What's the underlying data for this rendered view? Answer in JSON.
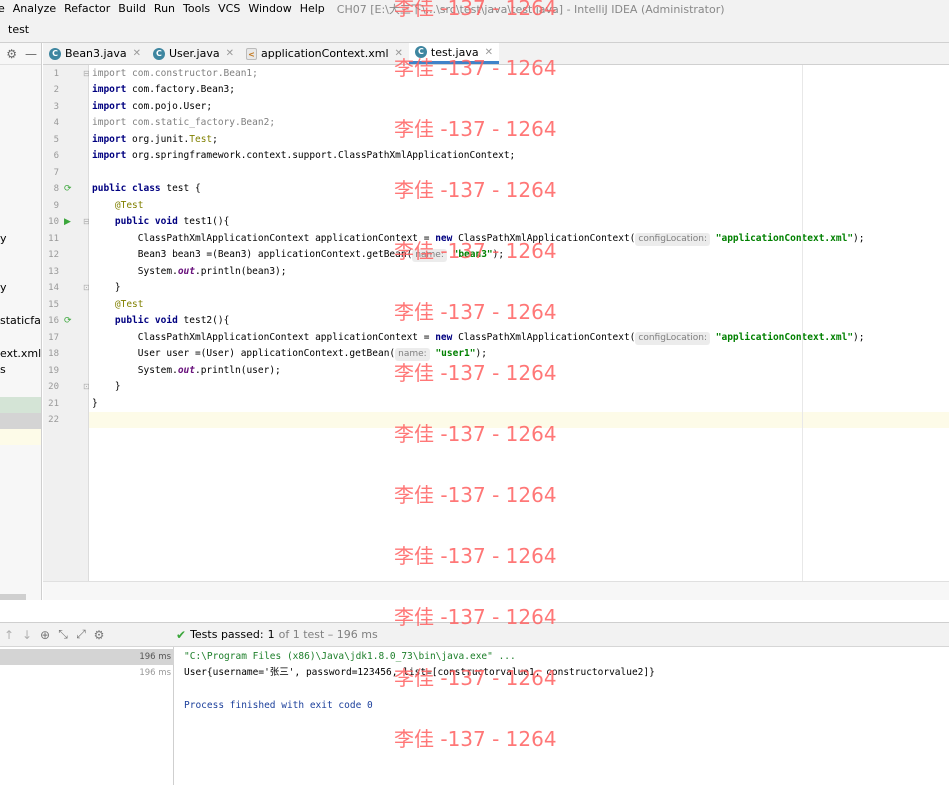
{
  "menubar": {
    "items": [
      "e",
      "Analyze",
      "Refactor",
      "Build",
      "Run",
      "Tools",
      "VCS",
      "Window",
      "Help"
    ],
    "window_title": "CH07 [E:\\大三下\\...\\src\\test\\java\\test.java] - IntelliJ IDEA (Administrator)"
  },
  "navbar": {
    "project": "test"
  },
  "project_panel": {
    "items": [
      "y",
      "y",
      "staticfact",
      "ext.xml",
      "s"
    ]
  },
  "tabs": [
    {
      "label": "Bean3.java",
      "icon": "java-class-icon",
      "active": false
    },
    {
      "label": "User.java",
      "icon": "java-class-icon",
      "active": false
    },
    {
      "label": "applicationContext.xml",
      "icon": "xml-file-icon",
      "active": false
    },
    {
      "label": "test.java",
      "icon": "java-class-icon",
      "active": true
    }
  ],
  "editor": {
    "line_numbers": [
      "1",
      "2",
      "3",
      "4",
      "5",
      "6",
      "7",
      "8",
      "9",
      "10",
      "11",
      "12",
      "13",
      "14",
      "15",
      "16",
      "17",
      "18",
      "19",
      "20",
      "21",
      "22"
    ],
    "lines": {
      "l1_kw": "import",
      "l1_rest": " com.constructor.Bean1;",
      "l2_kw": "import",
      "l2_rest": " com.factory.Bean3;",
      "l3_kw": "import",
      "l3_rest": " com.pojo.User;",
      "l4_kw": "import",
      "l4_rest": " com.static_factory.Bean2;",
      "l5_kw": "import",
      "l5_a": " org.junit.",
      "l5_ann": "Test",
      "l5_b": ";",
      "l6_kw": "import",
      "l6_rest": " org.springframework.context.support.ClassPathXmlApplicationContext;",
      "l8_kw": "public class",
      "l8_rest": " test {",
      "l9_ann": "@Test",
      "l10_kw": "public void",
      "l10_rest": " test1(){",
      "l11_a": "ClassPathXmlApplicationContext applicationContext = ",
      "l11_kw": "new",
      "l11_b": " ClassPathXmlApplicationContext(",
      "l11_hint": "configLocation:",
      "l11_str": "\"applicationContext.xml\"",
      "l11_c": ");",
      "l12_a": "Bean3 bean3 =(Bean3) applicationContext.getBean(",
      "l12_hint": "name:",
      "l12_str": "\"bean3\"",
      "l12_c": ");",
      "l13_a": "System.",
      "l13_fld": "out",
      "l13_b": ".println(bean3);",
      "l14": "}",
      "l15_ann": "@Test",
      "l16_kw": "public void",
      "l16_rest": " test2(){",
      "l17_a": "ClassPathXmlApplicationContext applicationContext = ",
      "l17_kw": "new",
      "l17_b": " ClassPathXmlApplicationContext(",
      "l17_hint": "configLocation:",
      "l17_str": "\"applicationContext.xml\"",
      "l17_c": ");",
      "l18_a": "User user =(User) applicationContext.getBean(",
      "l18_hint": "name:",
      "l18_str": "\"user1\"",
      "l18_c": ");",
      "l19_a": "System.",
      "l19_fld": "out",
      "l19_b": ".println(user);",
      "l20": "}",
      "l21": "}"
    }
  },
  "run": {
    "status_label": "Tests passed:",
    "status_count": "1",
    "status_rest": "of 1 test – 196 ms",
    "tree": [
      {
        "time": "196 ms"
      },
      {
        "time": "196 ms"
      }
    ],
    "console": {
      "cmd": "\"C:\\Program Files (x86)\\Java\\jdk1.8.0_73\\bin\\java.exe\" ...",
      "output": "User{username='张三', password=123456, list=[constructorvalue1, constructorvalue2]}",
      "exit": "Process finished with exit code 0"
    }
  },
  "watermark": "李佳 -137 - 1264",
  "colors": {
    "keyword": "#000080",
    "string": "#008000",
    "annotation": "#808000",
    "pass_green": "#3aa63a",
    "active_tab": "#4083c9",
    "watermark": "#ff6060"
  }
}
